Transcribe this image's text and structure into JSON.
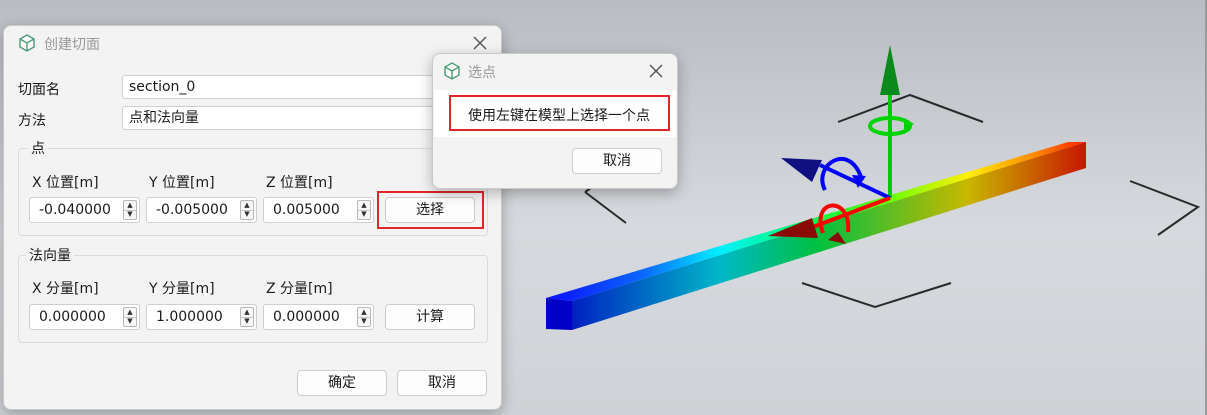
{
  "dialog_main": {
    "title": "创建切面",
    "section_name_label": "切面名",
    "section_name_value": "section_0",
    "method_label": "方法",
    "method_value": "点和法向量",
    "point_group": {
      "title": "点",
      "x_label": "X 位置[m]",
      "y_label": "Y 位置[m]",
      "z_label": "Z 位置[m]",
      "x_value": "-0.040000",
      "y_value": "-0.005000",
      "z_value": "0.005000",
      "select_button": "选择"
    },
    "normal_group": {
      "title": "法向量",
      "x_label": "X 分量[m]",
      "y_label": "Y 分量[m]",
      "z_label": "Z 分量[m]",
      "x_value": "0.000000",
      "y_value": "1.000000",
      "z_value": "0.000000",
      "compute_button": "计算"
    },
    "ok_button": "确定",
    "cancel_button": "取消"
  },
  "dialog_pick": {
    "title": "选点",
    "message": "使用左键在模型上选择一个点",
    "cancel_button": "取消"
  },
  "colors": {
    "highlight": "#e0262b",
    "axis_x": "#ff0000",
    "axis_y": "#00cc00",
    "axis_z": "#0000ff"
  },
  "icons": [
    "app-cube-icon",
    "close-icon",
    "spin-up-icon",
    "spin-down-icon"
  ]
}
